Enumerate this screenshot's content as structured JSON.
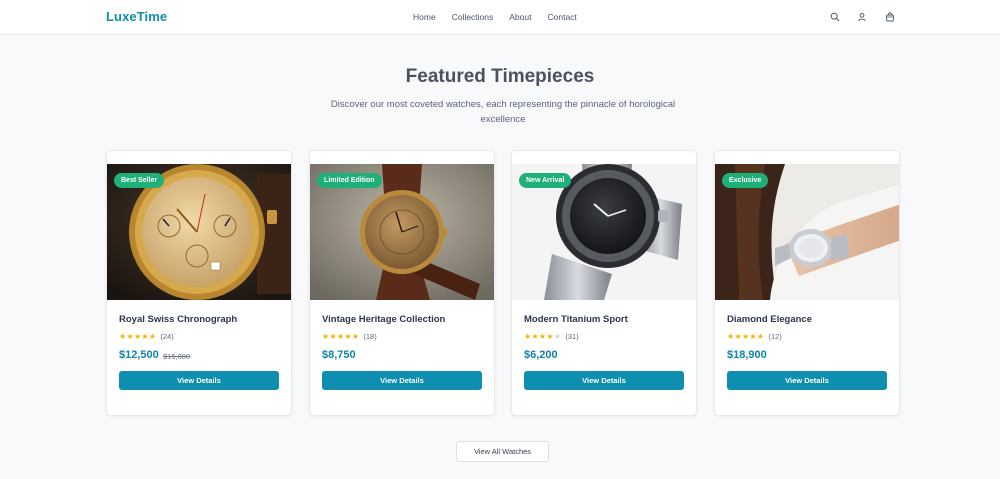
{
  "brand": "LuxeTime",
  "nav": {
    "links": [
      "Home",
      "Collections",
      "About",
      "Contact"
    ],
    "icons": [
      "search-icon",
      "user-icon",
      "cart-icon"
    ]
  },
  "section": {
    "title": "Featured Timepieces",
    "subtitle": "Discover our most coveted watches, each representing the pinnacle of horological excellence"
  },
  "products": [
    {
      "badge": "Best Seller",
      "name": "Royal Swiss Chronograph",
      "rating": 5,
      "reviews": "(24)",
      "price": "$12,500",
      "old_price": "$15,000",
      "button": "View Details",
      "image": "gold-chronograph-watch"
    },
    {
      "badge": "Limited Edition",
      "name": "Vintage Heritage Collection",
      "rating": 5,
      "reviews": "(18)",
      "price": "$8,750",
      "old_price": "",
      "button": "View Details",
      "image": "vintage-leather-watch"
    },
    {
      "badge": "New Arrival",
      "name": "Modern Titanium Sport",
      "rating": 4,
      "reviews": "(31)",
      "price": "$6,200",
      "old_price": "",
      "button": "View Details",
      "image": "titanium-dive-watch"
    },
    {
      "badge": "Exclusive",
      "name": "Diamond Elegance",
      "rating": 5,
      "reviews": "(12)",
      "price": "$18,900",
      "old_price": "",
      "button": "View Details",
      "image": "wrist-watch-model"
    }
  ],
  "view_all": "View All Watches",
  "colors": {
    "accent": "#0e8fb0",
    "badge": "#1fb07a",
    "star": "#f5b301"
  }
}
